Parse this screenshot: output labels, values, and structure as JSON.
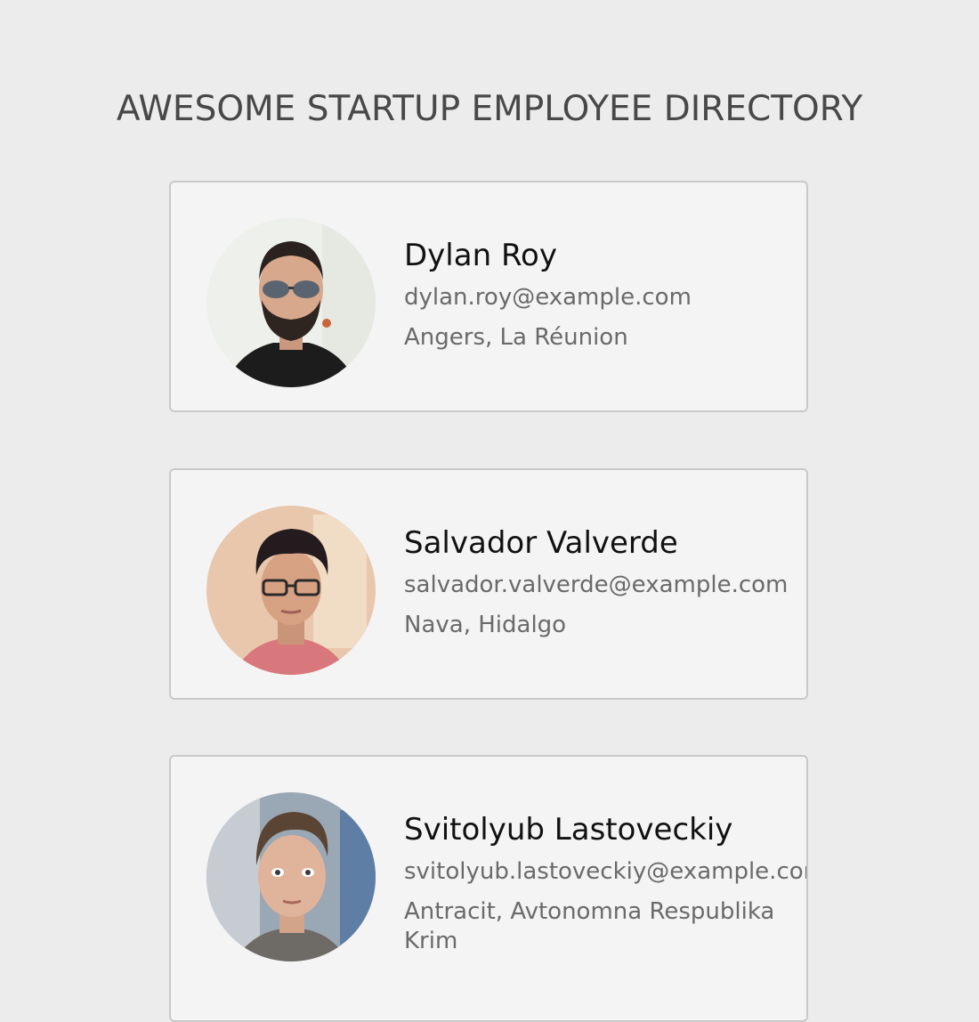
{
  "header": {
    "title": "AWESOME STARTUP EMPLOYEE DIRECTORY"
  },
  "employees": [
    {
      "name": "Dylan Roy",
      "email": "dylan.roy@example.com",
      "location": "Angers, La Réunion",
      "avatar_icon": "person-photo-sunglasses"
    },
    {
      "name": "Salvador Valverde",
      "email": "salvador.valverde@example.com",
      "location": "Nava, Hidalgo",
      "avatar_icon": "person-photo-glasses"
    },
    {
      "name": "Svitolyub Lastoveckiy",
      "email": "svitolyub.lastoveckiy@example.com",
      "location": "Antracit, Avtonomna Respublika Krim",
      "avatar_icon": "person-photo"
    }
  ],
  "colors": {
    "page_background": "#ececec",
    "card_background": "#f4f4f4",
    "card_border": "#c9c9c9",
    "title_text": "#484848",
    "secondary_text": "#6a6a6a"
  }
}
